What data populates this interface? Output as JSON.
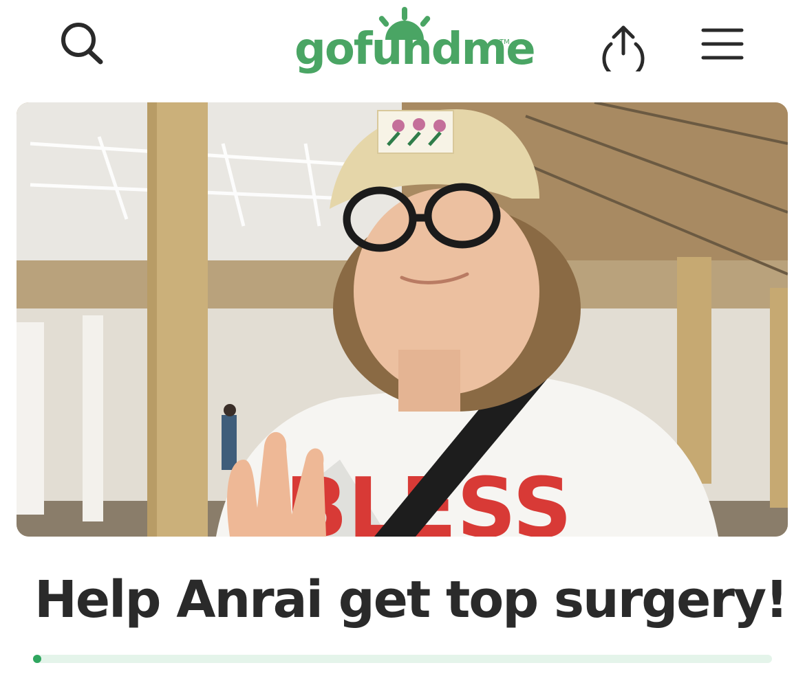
{
  "header": {
    "search_icon": "search-icon",
    "logo_text": "gofundme",
    "logo_tm": "TM",
    "share_icon": "share-icon",
    "menu_icon": "hamburger-menu-icon",
    "brand_color": "#4aa564"
  },
  "hero": {
    "image_description": "person wearing cap and glasses on a train platform"
  },
  "campaign": {
    "title": "Help Anrai get top surgery!",
    "progress_fraction": 0.01,
    "progress_color": "#2fa65f"
  }
}
